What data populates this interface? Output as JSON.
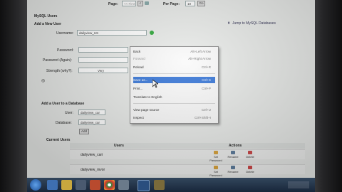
{
  "pagination": {
    "page_label": "Page:",
    "first": "<< First",
    "prev": "<",
    "per_page_label": "Per Page:",
    "per_page_value": "10",
    "go": "Go"
  },
  "section": {
    "title": "MySQL Users",
    "add_new_title": "Add a New User",
    "jump_link": "Jump to MySQL Databases"
  },
  "form": {
    "username_label": "Username:",
    "username_value": "dailyview_US",
    "password_label": "Password:",
    "password_again_label": "Password (Again):",
    "strength_label": "Strength (why?):",
    "strength_value": "Very"
  },
  "context_menu": {
    "items": [
      {
        "label": "Back",
        "shortcut": "Alt+Left Arrow",
        "enabled": true
      },
      {
        "label": "Forward",
        "shortcut": "Alt+Right Arrow",
        "enabled": false
      },
      {
        "label": "Reload",
        "shortcut": "Ctrl+R",
        "enabled": true
      },
      {
        "label": "Save as...",
        "shortcut": "Ctrl+S",
        "enabled": true,
        "highlighted": true
      },
      {
        "label": "Print...",
        "shortcut": "Ctrl+P",
        "enabled": true
      },
      {
        "label": "Translate to English",
        "shortcut": "",
        "enabled": true
      },
      {
        "label": "View page source",
        "shortcut": "Ctrl+U",
        "enabled": true
      },
      {
        "label": "Inspect",
        "shortcut": "Ctrl+Shift+I",
        "enabled": true
      }
    ]
  },
  "add_to_db": {
    "title": "Add a User to a Database",
    "user_label": "User:",
    "user_value": "dailyview_car",
    "database_label": "Database:",
    "database_value": "dailyview_car",
    "add_button": "Add"
  },
  "current_users": {
    "title": "Current Users",
    "col_users": "Users",
    "col_actions": "Actions",
    "rows": [
      {
        "user": "dailyview_cari",
        "actions": [
          "Set Password",
          "Rename",
          "Delete"
        ]
      },
      {
        "user": "dailyview_mvor",
        "actions": [
          "Set Password",
          "Rename",
          "Delete"
        ]
      }
    ]
  },
  "colors": {
    "highlight": "#3a78d8",
    "go_icon": "#2fa83a"
  }
}
